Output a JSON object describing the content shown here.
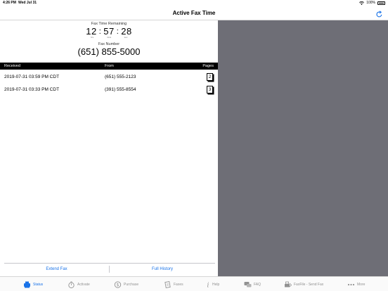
{
  "status_bar": {
    "time": "4:26 PM",
    "date": "Wed Jul 31",
    "battery": "100%"
  },
  "nav": {
    "title": "Active Fax Time"
  },
  "timer": {
    "label": "Fax Time Remaining",
    "hours": "12",
    "minutes": "57",
    "seconds": "28",
    "units": {
      "hours": "hrs",
      "minutes": "mins",
      "seconds": "sec"
    }
  },
  "fax": {
    "label": "Fax Number",
    "number": "(651) 855-5000"
  },
  "table": {
    "headers": {
      "received": "Received",
      "from": "From",
      "pages": "Pages"
    },
    "rows": [
      {
        "received": "2019-07-31 03:59 PM CDT",
        "from": "(651) 555-2123",
        "pages": "2"
      },
      {
        "received": "2019-07-31 03:33 PM CDT",
        "from": "(391) 555-8554",
        "pages": "3"
      }
    ]
  },
  "links": {
    "extend": "Extend Fax",
    "history": "Full History"
  },
  "tabs": [
    {
      "label": "Status",
      "icon": "fax-icon"
    },
    {
      "label": "Activate",
      "icon": "stopwatch-icon"
    },
    {
      "label": "Purchase",
      "icon": "dollar-icon"
    },
    {
      "label": "Faxes",
      "icon": "documents-icon"
    },
    {
      "label": "Help",
      "icon": "info-icon"
    },
    {
      "label": "FAQ",
      "icon": "chat-icon"
    },
    {
      "label": "FaxFile - Send Fax",
      "icon": "send-fax-icon"
    },
    {
      "label": "More",
      "icon": "more-icon"
    }
  ],
  "colors": {
    "accent": "#1a73e8",
    "tab_inactive": "#929292",
    "detail_pane": "#6e6e76",
    "header_bg": "#000000"
  }
}
